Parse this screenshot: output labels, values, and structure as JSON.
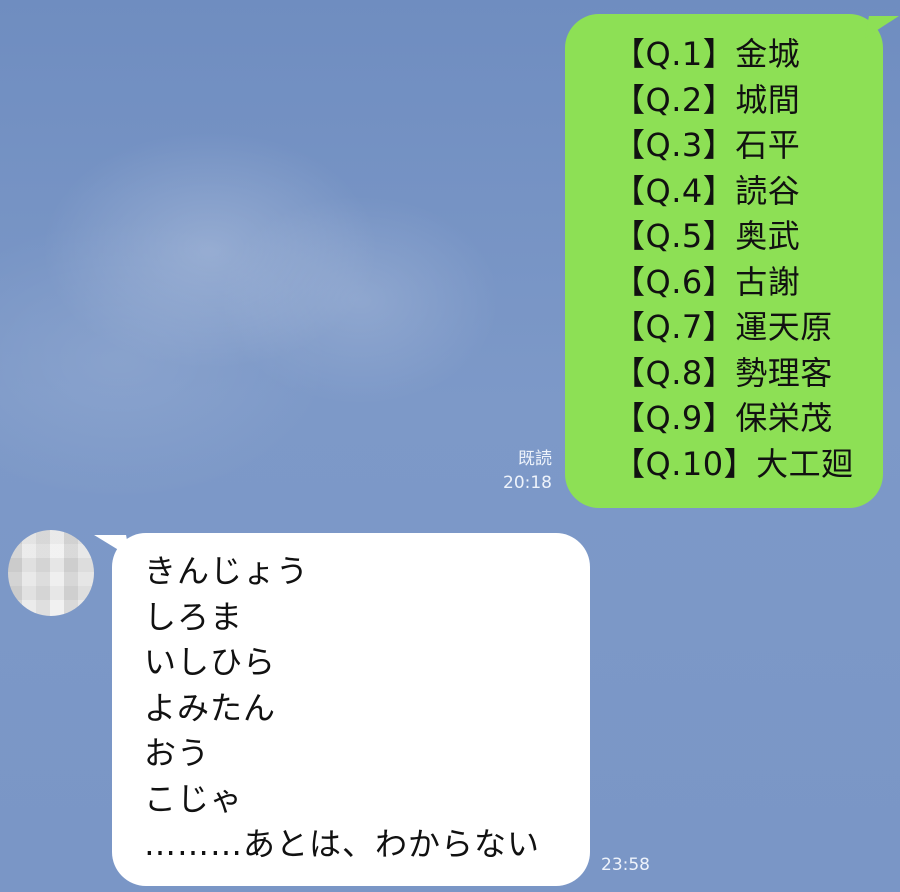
{
  "theme": {
    "background": "#7b97c6",
    "outgoing_bubble": "#8de055",
    "incoming_bubble": "#ffffff"
  },
  "messages": [
    {
      "direction": "outgoing",
      "lines": [
        "【Q.1】金城",
        "【Q.2】城間",
        "【Q.3】石平",
        "【Q.4】読谷",
        "【Q.5】奥武",
        "【Q.6】古謝",
        "【Q.7】運天原",
        "【Q.8】勢理客",
        "【Q.9】保栄茂",
        "【Q.10】大工廻"
      ],
      "read_status": "既読",
      "time": "20:18"
    },
    {
      "direction": "incoming",
      "avatar_icon": "pixelated-avatar-icon",
      "lines": [
        "きんじょう",
        "しろま",
        "いしひら",
        "よみたん",
        "おう",
        "こじゃ",
        "………あとは、わからない"
      ],
      "time": "23:58"
    }
  ]
}
